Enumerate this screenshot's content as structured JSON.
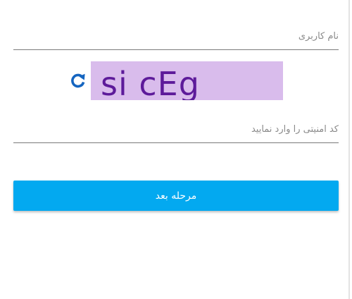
{
  "form": {
    "username": {
      "placeholder": "نام کاربری",
      "value": ""
    },
    "captcha": {
      "image_text": "si cEg",
      "refresh_icon": "refresh-icon",
      "background_color": "#d9bcec",
      "text_color": "#5d1a9a",
      "input_placeholder": "کد امنیتی را وارد نمایید",
      "input_value": ""
    },
    "next_button": {
      "label": "مرحله بعد",
      "color": "#03a9f0"
    }
  }
}
